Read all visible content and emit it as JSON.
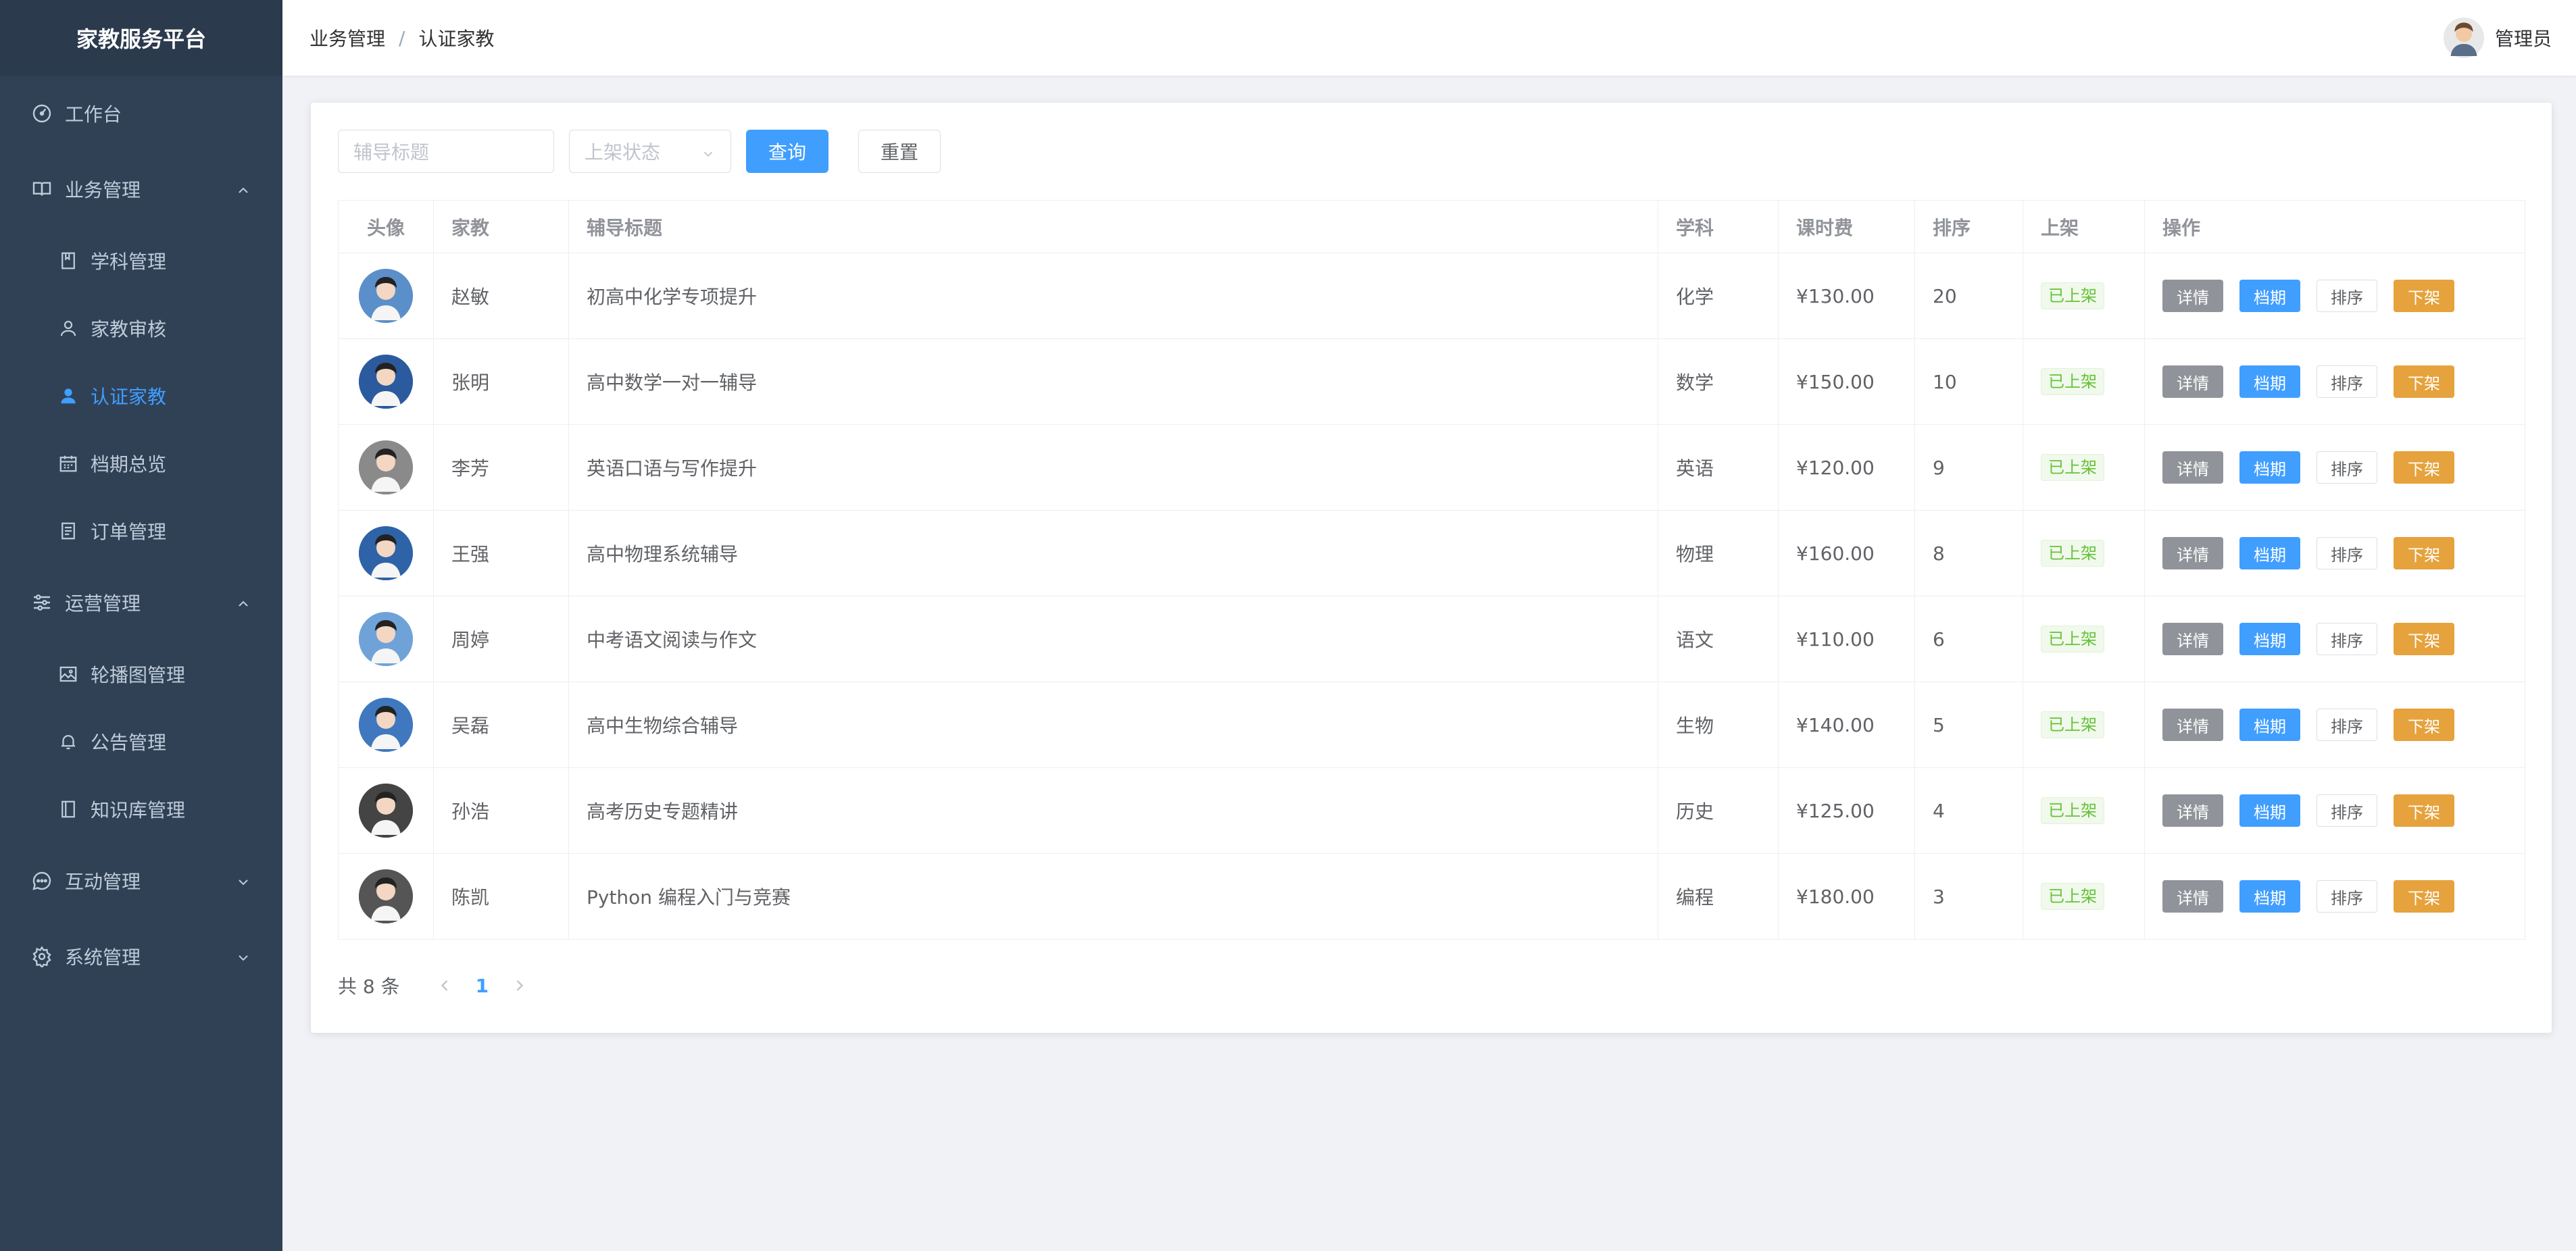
{
  "app_title": "家教服务平台",
  "sidebar": {
    "workbench": {
      "label": "工作台",
      "icon": "dashboard-icon"
    },
    "business": {
      "label": "业务管理",
      "icon": "book-open-icon",
      "expanded": true,
      "items": [
        {
          "label": "学科管理",
          "icon": "bookmark-icon"
        },
        {
          "label": "家教审核",
          "icon": "user-icon"
        },
        {
          "label": "认证家教",
          "icon": "user-filled-icon",
          "active": true
        },
        {
          "label": "档期总览",
          "icon": "calendar-icon"
        },
        {
          "label": "订单管理",
          "icon": "document-icon"
        }
      ]
    },
    "operations": {
      "label": "运营管理",
      "icon": "sliders-icon",
      "expanded": true,
      "items": [
        {
          "label": "轮播图管理",
          "icon": "picture-icon"
        },
        {
          "label": "公告管理",
          "icon": "bell-icon"
        },
        {
          "label": "知识库管理",
          "icon": "notebook-icon"
        }
      ]
    },
    "interaction": {
      "label": "互动管理",
      "icon": "chat-icon",
      "expanded": false
    },
    "system": {
      "label": "系统管理",
      "icon": "gear-icon",
      "expanded": false
    }
  },
  "header": {
    "breadcrumb": [
      "业务管理",
      "认证家教"
    ],
    "separator": "/",
    "user_name": "管理员"
  },
  "filters": {
    "title_placeholder": "辅导标题",
    "status_placeholder": "上架状态",
    "query_label": "查询",
    "reset_label": "重置"
  },
  "table": {
    "columns": [
      "头像",
      "家教",
      "辅导标题",
      "学科",
      "课时费",
      "排序",
      "上架",
      "操作"
    ],
    "rows": [
      {
        "name": "赵敏",
        "title": "初高中化学专项提升",
        "subject": "化学",
        "fee": "¥130.00",
        "sort": "20",
        "status": "已上架",
        "avatar_color": "#5b8fc9"
      },
      {
        "name": "张明",
        "title": "高中数学一对一辅导",
        "subject": "数学",
        "fee": "¥150.00",
        "sort": "10",
        "status": "已上架",
        "avatar_color": "#2c5a9e"
      },
      {
        "name": "李芳",
        "title": "英语口语与写作提升",
        "subject": "英语",
        "fee": "¥120.00",
        "sort": "9",
        "status": "已上架",
        "avatar_color": "#8a8a8a"
      },
      {
        "name": "王强",
        "title": "高中物理系统辅导",
        "subject": "物理",
        "fee": "¥160.00",
        "sort": "8",
        "status": "已上架",
        "avatar_color": "#2f63a8"
      },
      {
        "name": "周婷",
        "title": "中考语文阅读与作文",
        "subject": "语文",
        "fee": "¥110.00",
        "sort": "6",
        "status": "已上架",
        "avatar_color": "#6fa3d8"
      },
      {
        "name": "吴磊",
        "title": "高中生物综合辅导",
        "subject": "生物",
        "fee": "¥140.00",
        "sort": "5",
        "status": "已上架",
        "avatar_color": "#3f78bf"
      },
      {
        "name": "孙浩",
        "title": "高考历史专题精讲",
        "subject": "历史",
        "fee": "¥125.00",
        "sort": "4",
        "status": "已上架",
        "avatar_color": "#444444"
      },
      {
        "name": "陈凯",
        "title": "Python 编程入门与竞赛",
        "subject": "编程",
        "fee": "¥180.00",
        "sort": "3",
        "status": "已上架",
        "avatar_color": "#555555"
      }
    ],
    "actions": {
      "detail": "详情",
      "schedule": "档期",
      "sort": "排序",
      "offline": "下架"
    }
  },
  "pagination": {
    "total_text": "共 8 条",
    "current_page": "1"
  },
  "colors": {
    "sidebar_bg": "#304156",
    "accent": "#409eff",
    "warning": "#e6a23c",
    "success": "#67c23a",
    "info": "#909399"
  }
}
